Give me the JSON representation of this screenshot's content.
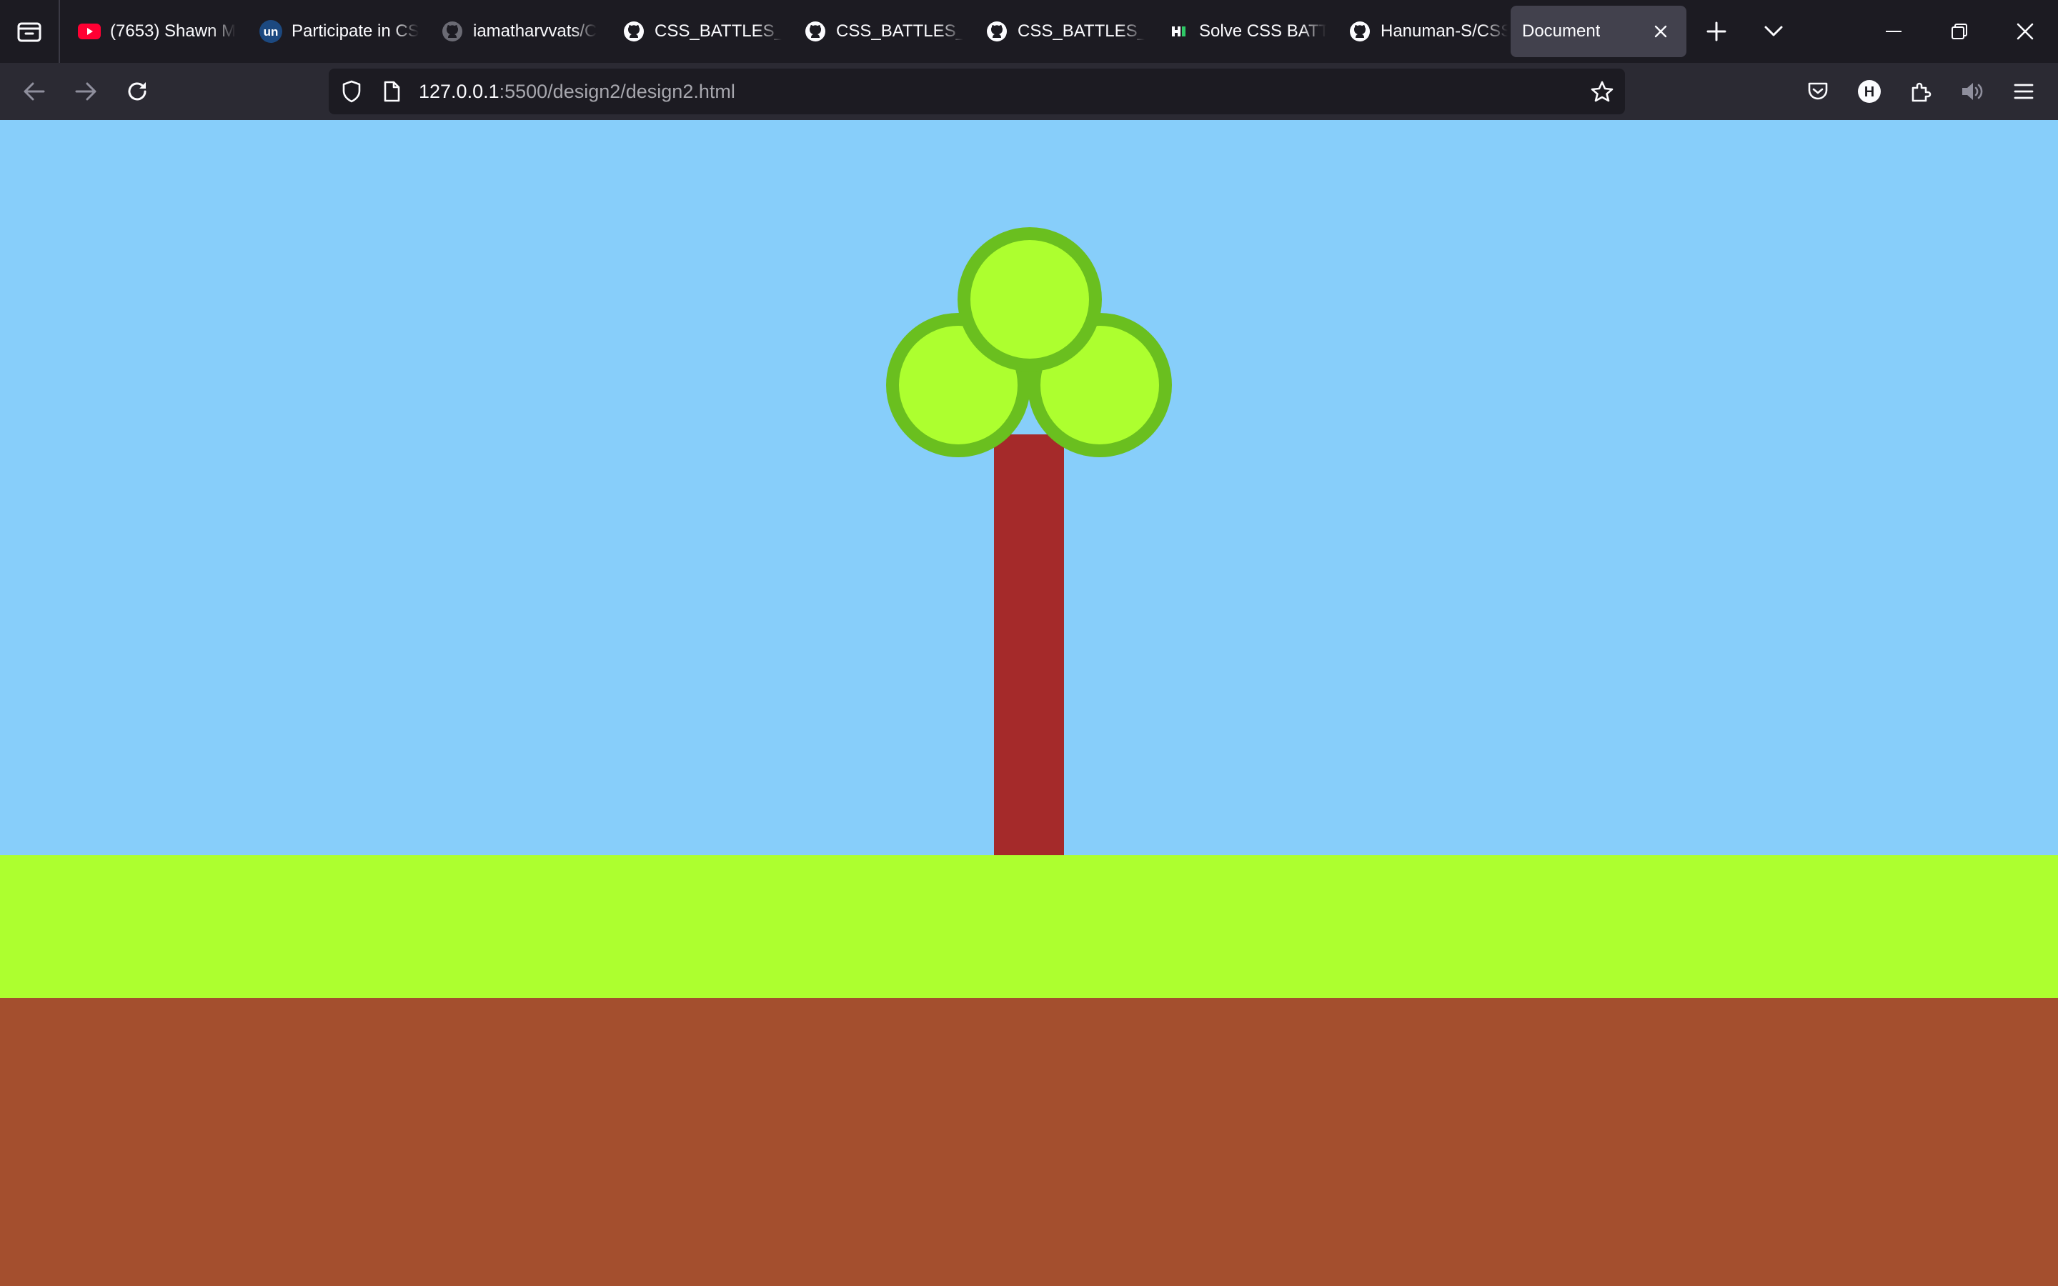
{
  "browser": {
    "tabs": [
      {
        "title": "(7653) Shawn M",
        "favicon": "youtube-icon"
      },
      {
        "title": "Participate in CS",
        "favicon": "unstop-icon"
      },
      {
        "title": "iamatharvvats/C",
        "favicon": "github-icon"
      },
      {
        "title": "CSS_BATTLES_B",
        "favicon": "github-icon"
      },
      {
        "title": "CSS_BATTLES_B",
        "favicon": "github-icon"
      },
      {
        "title": "CSS_BATTLES_B",
        "favicon": "github-icon"
      },
      {
        "title": "Solve CSS BATT",
        "favicon": "hackerearth-icon"
      },
      {
        "title": "Hanuman-S/CSS",
        "favicon": "github-icon"
      },
      {
        "title": "Document",
        "active": true
      }
    ],
    "url": {
      "host": "127.0.0.1",
      "path": ":5500/design2/design2.html"
    },
    "toolbar_avatar_letter": "H"
  },
  "scene": {
    "sky_color": "#87cefa",
    "grass_color": "#adff2f",
    "soil_color": "#a44f2e",
    "trunk_color": "#a52a2a",
    "leaf_fill": "#adff2f",
    "leaf_border": "#6abf1f"
  },
  "colors": {
    "tabbar_bg": "#1c1b22",
    "navbar_bg": "#2b2a33",
    "active_tab_bg": "#42414d"
  }
}
